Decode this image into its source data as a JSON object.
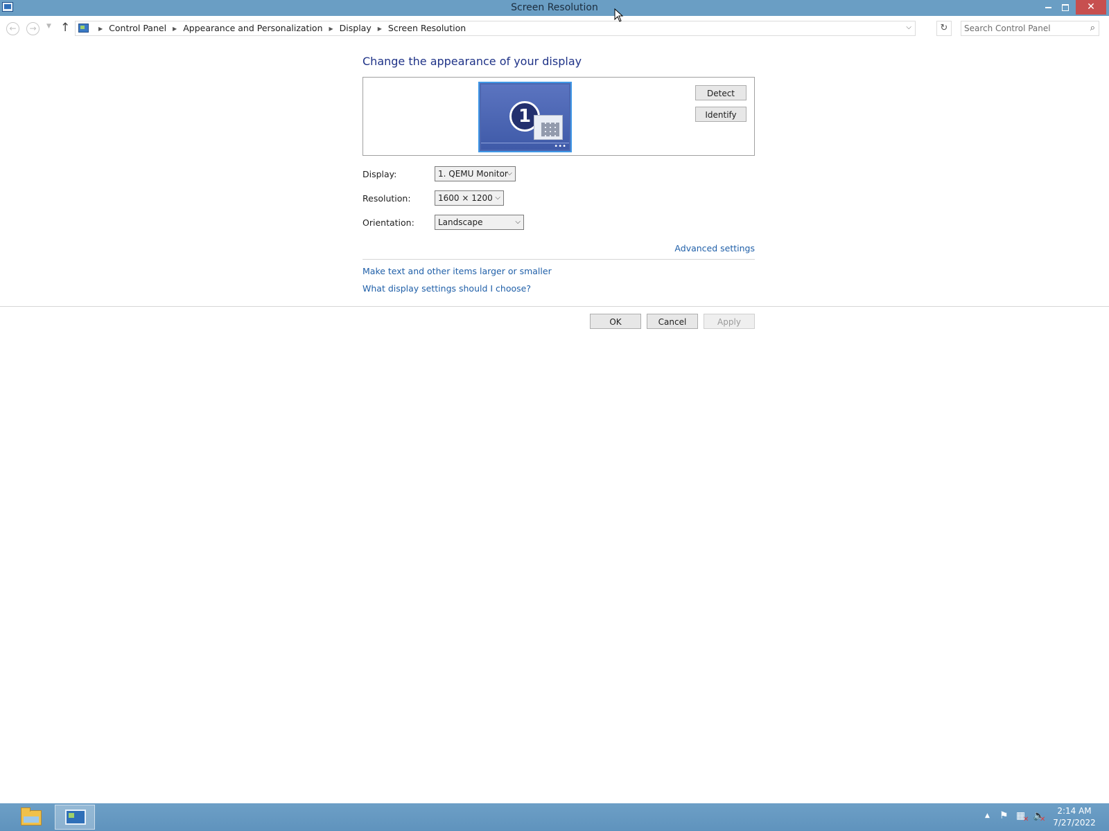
{
  "window": {
    "title": "Screen Resolution"
  },
  "nav": {
    "breadcrumbs": [
      "Control Panel",
      "Appearance and Personalization",
      "Display",
      "Screen Resolution"
    ],
    "search_placeholder": "Search Control Panel"
  },
  "main": {
    "heading": "Change the appearance of your display",
    "monitor_number": "1",
    "detect_label": "Detect",
    "identify_label": "Identify",
    "display_label": "Display:",
    "display_value": "1. QEMU Monitor",
    "resolution_label": "Resolution:",
    "resolution_value": "1600 × 1200",
    "orientation_label": "Orientation:",
    "orientation_value": "Landscape",
    "advanced_link": "Advanced settings",
    "text_size_link": "Make text and other items larger or smaller",
    "help_link": "What display settings should I choose?"
  },
  "footer": {
    "ok_label": "OK",
    "cancel_label": "Cancel",
    "apply_label": "Apply"
  },
  "taskbar": {
    "time": "2:14 AM",
    "date": "7/27/2022"
  },
  "colors": {
    "titlebar": "#6a9ec4",
    "taskbar": "#6d9fc6",
    "heading": "#1e3287",
    "link": "#1f5fa8",
    "close_button": "#c74f4f"
  }
}
